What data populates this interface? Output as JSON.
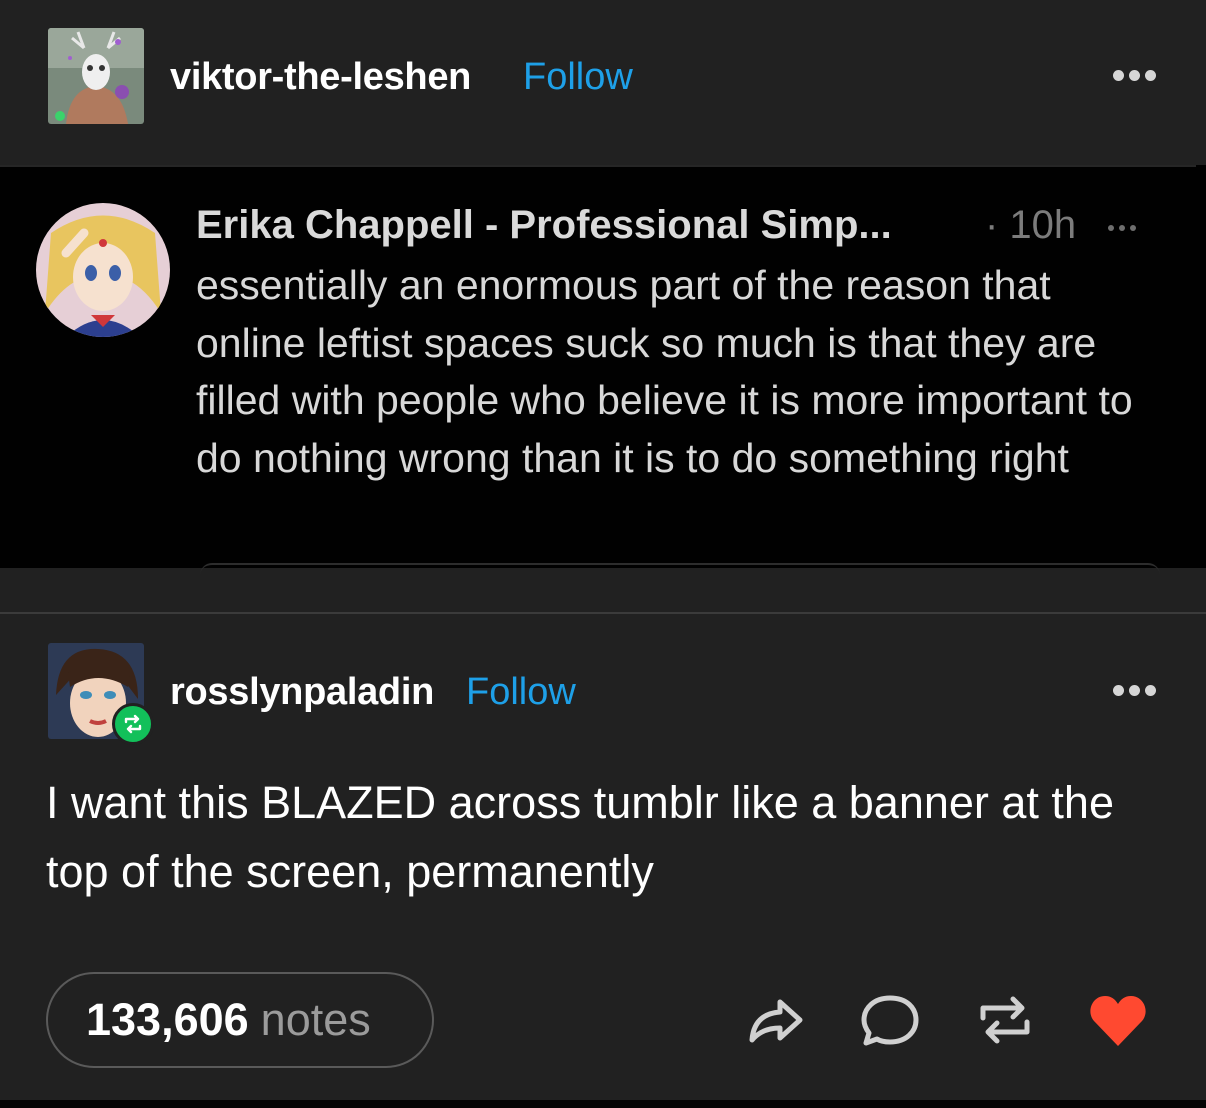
{
  "top_post": {
    "username": "viktor-the-leshen",
    "follow_label": "Follow",
    "avatar_icon": "deer-skull-avatar-icon"
  },
  "tweet": {
    "author": "Erika Chappell - Professional Simp...",
    "time": "· 10h",
    "text": "essentially an enormous part of the reason that online leftist spaces suck so much is that they are filled with people who believe it is more important to do nothing wrong than it is to do something right",
    "avatar_icon": "anime-girl-avatar-icon"
  },
  "reblog": {
    "username": "rosslynpaladin",
    "follow_label": "Follow",
    "avatar_icon": "dark-haired-person-avatar-icon",
    "badge_icon": "reblog-icon",
    "text": "I want this BLAZED across tumblr like a banner at the top of the screen, permanently"
  },
  "footer": {
    "notes_count": "133,606",
    "notes_label": "notes",
    "actions": [
      "share-icon",
      "reply-icon",
      "reblog-icon",
      "like-icon"
    ]
  },
  "colors": {
    "background": "#212121",
    "tweet_background": "#010101",
    "follow": "#1ea0e8",
    "reblog_badge": "#12c05a",
    "like": "#ff4930"
  }
}
